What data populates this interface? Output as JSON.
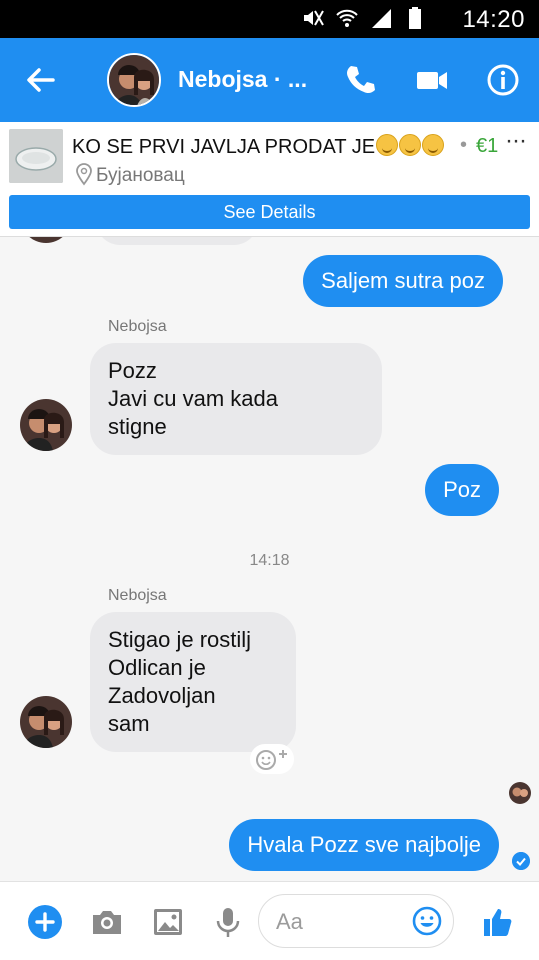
{
  "status": {
    "time": "14:20"
  },
  "header": {
    "title": "Nebojsa · ..."
  },
  "listing": {
    "title": "KO SE PRVI JAVLJA PRODAT JE",
    "price": "€1",
    "dot": "•",
    "more": "···",
    "location": "Бујановац",
    "details_label": "See Details"
  },
  "messages": [
    {
      "from": "me",
      "text": "Saljem sutra poz"
    },
    {
      "from": "them",
      "sender": "Nebojsa",
      "lines": [
        "Pozz",
        "Javi cu vam kada",
        "stigne"
      ]
    },
    {
      "from": "me",
      "text": "Poz"
    },
    {
      "timestamp": "14:18"
    },
    {
      "from": "them",
      "sender": "Nebojsa",
      "lines": [
        "Stigao je rostilj",
        "Odlican je",
        "Zadovoljan",
        "sam"
      ]
    },
    {
      "from": "me",
      "text": "Hvala Pozz sve najbolje"
    }
  ],
  "composer": {
    "placeholder": "Aa"
  },
  "colors": {
    "accent": "#1f8ef1",
    "incoming": "#e9e9eb",
    "price": "#3aa63a"
  },
  "icons": [
    "mute-icon",
    "wifi-icon",
    "signal-icon",
    "battery-icon",
    "back-arrow-icon",
    "phone-icon",
    "video-camera-icon",
    "info-icon",
    "location-pin-icon",
    "add-icon",
    "camera-icon",
    "gallery-icon",
    "microphone-icon",
    "emoji-icon",
    "thumbs-up-icon",
    "add-reaction-icon"
  ]
}
